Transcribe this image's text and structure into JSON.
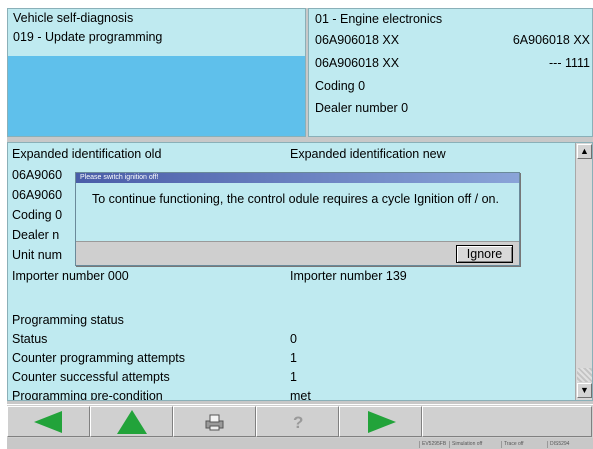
{
  "header": {
    "function": "Vehicle self-diagnosis",
    "step": "019 - Update programming",
    "module_title": "01 - Engine electronics",
    "part_number": "06A906018 XX",
    "part_number_right": "6A906018 XX",
    "part_number_2": "06A906018 XX",
    "version_right": "--- 1111",
    "coding": "Coding 0",
    "dealer": "Dealer number 0"
  },
  "list": {
    "header_old": "Expanded identification old",
    "header_new": "Expanded identification new",
    "rows": [
      {
        "old": "06A9060",
        "new": ""
      },
      {
        "old": "06A9060",
        "new": ""
      },
      {
        "old": "Coding 0",
        "new": ""
      },
      {
        "old": "Dealer n",
        "new": ""
      },
      {
        "old": "Unit num",
        "new": ""
      },
      {
        "old": "Importer number 000",
        "new": "Importer number 139"
      }
    ],
    "section_title": "Programming status",
    "status_rows": [
      {
        "label": "Status",
        "value": "0"
      },
      {
        "label": "Counter programming attempts",
        "value": "1"
      },
      {
        "label": "Counter successful attempts",
        "value": "1"
      },
      {
        "label": "Programming pre-condition",
        "value": "met"
      }
    ]
  },
  "dialog": {
    "title": "Please switch ignition off!",
    "message": "To continue functioning, the control odule requires a cycle Ignition off / on.",
    "ignore_label": "Ignore"
  },
  "toolbar": {
    "icons": [
      "arrow-left-icon",
      "arrow-up-icon",
      "print-icon",
      "help-icon",
      "arrow-right-icon"
    ],
    "accent": "#22a33a"
  },
  "statusbar": {
    "items": [
      "EV5295FB",
      "Simulation off",
      "Trace off",
      "DIS5294"
    ]
  }
}
